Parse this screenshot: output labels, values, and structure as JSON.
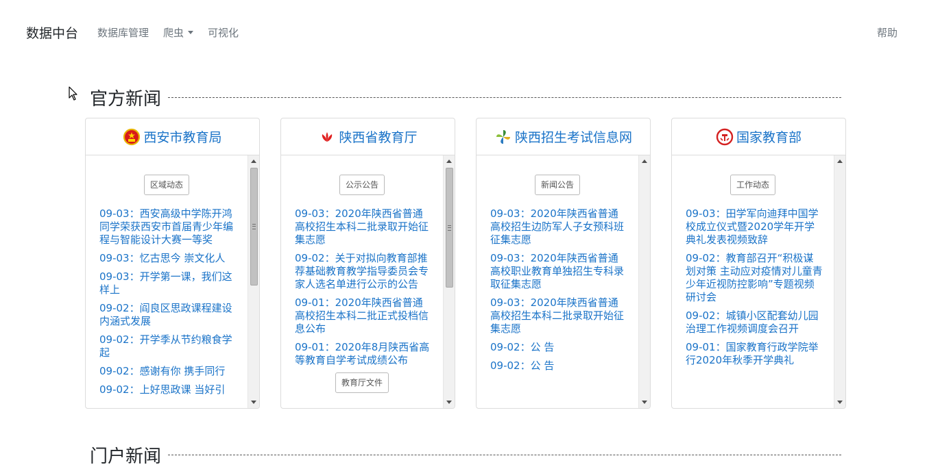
{
  "navbar": {
    "brand": "数据中台",
    "items": [
      {
        "label": "数据库管理"
      },
      {
        "label": "爬虫"
      },
      {
        "label": "可视化"
      }
    ],
    "help": "帮助"
  },
  "sections": {
    "official_news": "官方新闻",
    "portal_news": "门户新闻"
  },
  "cards": [
    {
      "title": "西安市教育局",
      "logo": "national-emblem-icon",
      "category": "区域动态",
      "items": [
        "09-03：西安高级中学陈开鸿同学荣获西安市首届青少年编程与智能设计大赛一等奖",
        "09-03：忆古思今 崇文化人",
        "09-03：开学第一课，我们这样上",
        "09-02：阎良区思政课程建设内涵式发展",
        "09-02：开学季从节约粮食学起",
        "09-02：感谢有你 携手同行",
        "09-02：上好思政课 当好引"
      ],
      "category2": ""
    },
    {
      "title": "陕西省教育厅",
      "logo": "red-flower-logo-icon",
      "category": "公示公告",
      "items": [
        "09-03：2020年陕西省普通高校招生本科二批录取开始征集志愿",
        "09-02：关于对拟向教育部推荐基础教育教学指导委员会专家人选名单进行公示的公告",
        "09-01：2020年陕西省普通高校招生本科二批正式投档信息公布",
        "09-01：2020年8月陕西省高等教育自学考试成绩公布"
      ],
      "category2": "教育厅文件"
    },
    {
      "title": "陕西招生考试信息网",
      "logo": "pinwheel-logo-icon",
      "category": "新闻公告",
      "items": [
        "09-03：2020年陕西省普通高校招生边防军人子女预科班征集志愿",
        "09-03：2020年陕西省普通高校职业教育单独招生专科录取征集志愿",
        "09-03：2020年陕西省普通高校招生本科二批录取开始征集志愿",
        "09-02：公 告",
        "09-02：公 告"
      ],
      "category2": ""
    },
    {
      "title": "国家教育部",
      "logo": "moe-emblem-icon",
      "category": "工作动态",
      "items": [
        "09-03：田学军向迪拜中国学校成立仪式暨2020学年开学典礼发表视频致辞",
        "09-02：教育部召开“积极谋划对策 主动应对疫情对儿童青少年近视防控影响”专题视频研讨会",
        "09-02：城镇小区配套幼儿园治理工作视频调度会召开",
        "09-01：国家教育行政学院举行2020年秋季开学典礼"
      ],
      "category2": ""
    }
  ],
  "colors": {
    "link": "#1a73c8",
    "nav_text": "#6c757d",
    "border": "#dcdcdc"
  }
}
